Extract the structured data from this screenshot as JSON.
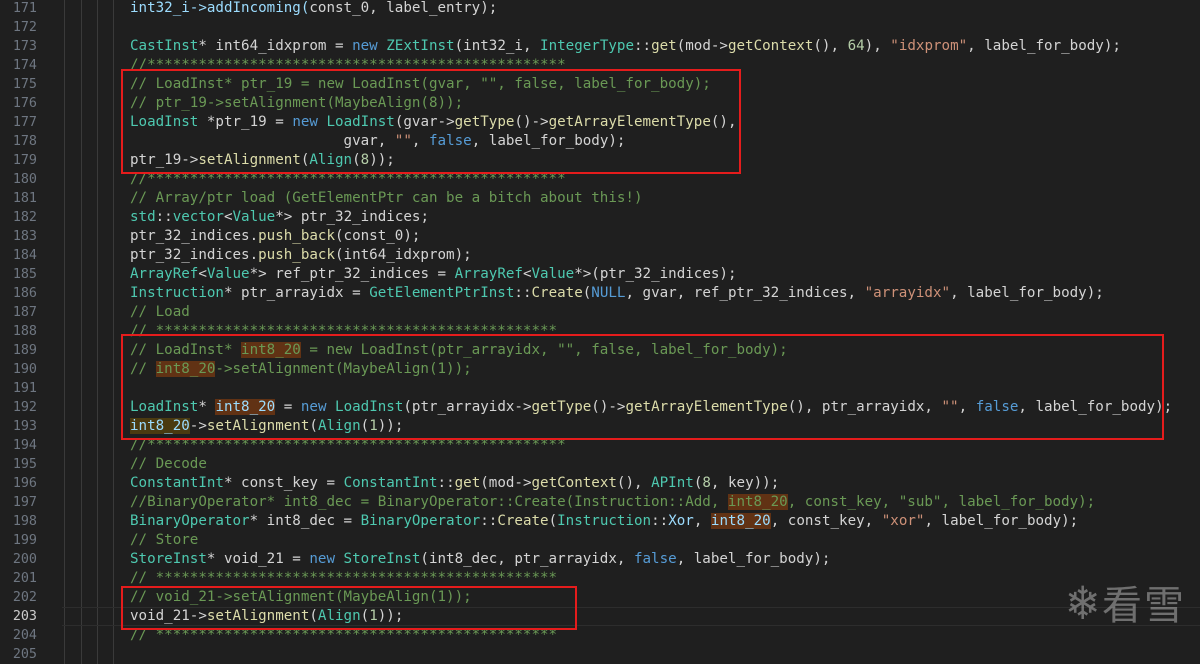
{
  "editor": {
    "current_line": 203,
    "lines": [
      {
        "n": 171,
        "tokens": [
          [
            "int32_i->addIncoming(",
            "var"
          ],
          [
            "const_0, label_entry",
            ""
          ],
          [
            ");",
            ""
          ]
        ]
      },
      {
        "n": 172,
        "tokens": []
      },
      {
        "n": 173,
        "tokens": [
          [
            "CastInst",
            "type"
          ],
          [
            "* int64_idxprom = ",
            ""
          ],
          [
            "new ",
            "kw"
          ],
          [
            "ZExtInst",
            "type"
          ],
          [
            "(int32_i, ",
            ""
          ],
          [
            "IntegerType",
            "type"
          ],
          [
            "::",
            ""
          ],
          [
            "get",
            "fn"
          ],
          [
            "(mod->",
            ""
          ],
          [
            "getContext",
            "fn"
          ],
          [
            "(), ",
            ""
          ],
          [
            "64",
            "num"
          ],
          [
            "), ",
            ""
          ],
          [
            "\"idxprom\"",
            "str"
          ],
          [
            ", label_for_body);",
            ""
          ]
        ]
      },
      {
        "n": 174,
        "tokens": [
          [
            "//*************************************************",
            "cm"
          ]
        ]
      },
      {
        "n": 175,
        "tokens": [
          [
            "// LoadInst* ptr_19 = new LoadInst(gvar, \"\", false, label_for_body);",
            "cm"
          ]
        ]
      },
      {
        "n": 176,
        "tokens": [
          [
            "// ptr_19->setAlignment(MaybeAlign(8));",
            "cm"
          ]
        ]
      },
      {
        "n": 177,
        "tokens": [
          [
            "LoadInst",
            "type"
          ],
          [
            " *ptr_19 = ",
            ""
          ],
          [
            "new ",
            "kw"
          ],
          [
            "LoadInst",
            "type"
          ],
          [
            "(gvar->",
            ""
          ],
          [
            "getType",
            "fn"
          ],
          [
            "()->",
            ""
          ],
          [
            "getArrayElementType",
            "fn"
          ],
          [
            "(),",
            ""
          ]
        ]
      },
      {
        "n": 178,
        "tokens": [
          [
            "                         gvar, ",
            ""
          ],
          [
            "\"\"",
            "str"
          ],
          [
            ", ",
            ""
          ],
          [
            "false",
            "kw"
          ],
          [
            ", label_for_body);",
            ""
          ]
        ]
      },
      {
        "n": 179,
        "tokens": [
          [
            "ptr_19->",
            ""
          ],
          [
            "setAlignment",
            "fn"
          ],
          [
            "(",
            ""
          ],
          [
            "Align",
            "type"
          ],
          [
            "(",
            ""
          ],
          [
            "8",
            "num"
          ],
          [
            "));",
            ""
          ]
        ]
      },
      {
        "n": 180,
        "tokens": [
          [
            "//*************************************************",
            "cm"
          ]
        ]
      },
      {
        "n": 181,
        "tokens": [
          [
            "// Array/ptr load (GetElementPtr can be a bitch about this!)",
            "cm"
          ]
        ]
      },
      {
        "n": 182,
        "tokens": [
          [
            "std",
            "type"
          ],
          [
            "::",
            ""
          ],
          [
            "vector",
            "type"
          ],
          [
            "<",
            ""
          ],
          [
            "Value",
            "type"
          ],
          [
            "*> ptr_32_indices;",
            ""
          ]
        ]
      },
      {
        "n": 183,
        "tokens": [
          [
            "ptr_32_indices.",
            ""
          ],
          [
            "push_back",
            "fn"
          ],
          [
            "(const_0);",
            ""
          ]
        ]
      },
      {
        "n": 184,
        "tokens": [
          [
            "ptr_32_indices.",
            ""
          ],
          [
            "push_back",
            "fn"
          ],
          [
            "(int64_idxprom);",
            ""
          ]
        ]
      },
      {
        "n": 185,
        "tokens": [
          [
            "ArrayRef",
            "type"
          ],
          [
            "<",
            ""
          ],
          [
            "Value",
            "type"
          ],
          [
            "*> ref_ptr_32_indices = ",
            ""
          ],
          [
            "ArrayRef",
            "type"
          ],
          [
            "<",
            ""
          ],
          [
            "Value",
            "type"
          ],
          [
            "*>(ptr_32_indices);",
            ""
          ]
        ]
      },
      {
        "n": 186,
        "tokens": [
          [
            "Instruction",
            "type"
          ],
          [
            "* ptr_arrayidx = ",
            ""
          ],
          [
            "GetElementPtrInst",
            "type"
          ],
          [
            "::",
            ""
          ],
          [
            "Create",
            "fn"
          ],
          [
            "(",
            ""
          ],
          [
            "NULL",
            "kw"
          ],
          [
            ", gvar, ref_ptr_32_indices, ",
            ""
          ],
          [
            "\"arrayidx\"",
            "str"
          ],
          [
            ", label_for_body);",
            ""
          ]
        ]
      },
      {
        "n": 187,
        "tokens": [
          [
            "// Load",
            "cm"
          ]
        ]
      },
      {
        "n": 188,
        "tokens": [
          [
            "// ***********************************************",
            "cm"
          ]
        ]
      },
      {
        "n": 189,
        "tokens": [
          [
            "// LoadInst* ",
            "cm"
          ],
          [
            "int8_20",
            "cmhl"
          ],
          [
            " = new LoadInst(ptr_arrayidx, \"\", false, label_for_body);",
            "cm"
          ]
        ]
      },
      {
        "n": 190,
        "tokens": [
          [
            "// ",
            "cm"
          ],
          [
            "int8_20",
            "cmhl"
          ],
          [
            "->setAlignment(MaybeAlign(1));",
            "cm"
          ]
        ]
      },
      {
        "n": 191,
        "tokens": []
      },
      {
        "n": 192,
        "tokens": [
          [
            "LoadInst",
            "type"
          ],
          [
            "* ",
            ""
          ],
          [
            "int8_20",
            "hl"
          ],
          [
            " = ",
            ""
          ],
          [
            "new ",
            "kw"
          ],
          [
            "LoadInst",
            "type"
          ],
          [
            "(ptr_arrayidx->",
            ""
          ],
          [
            "getType",
            "fn"
          ],
          [
            "()->",
            ""
          ],
          [
            "getArrayElementType",
            "fn"
          ],
          [
            "(), ptr_arrayidx, ",
            ""
          ],
          [
            "\"\"",
            "str"
          ],
          [
            ", ",
            ""
          ],
          [
            "false",
            "kw"
          ],
          [
            ", label_for_body);",
            ""
          ]
        ]
      },
      {
        "n": 193,
        "tokens": [
          [
            "int8_20",
            "hl2"
          ],
          [
            "->",
            ""
          ],
          [
            "setAlignment",
            "fn"
          ],
          [
            "(",
            ""
          ],
          [
            "Align",
            "type"
          ],
          [
            "(",
            ""
          ],
          [
            "1",
            "num"
          ],
          [
            "));",
            ""
          ]
        ]
      },
      {
        "n": 194,
        "tokens": [
          [
            "//*************************************************",
            "cm"
          ]
        ]
      },
      {
        "n": 195,
        "tokens": [
          [
            "// Decode",
            "cm"
          ]
        ]
      },
      {
        "n": 196,
        "tokens": [
          [
            "ConstantInt",
            "type"
          ],
          [
            "* const_key = ",
            ""
          ],
          [
            "ConstantInt",
            "type"
          ],
          [
            "::",
            ""
          ],
          [
            "get",
            "fn"
          ],
          [
            "(mod->",
            ""
          ],
          [
            "getContext",
            "fn"
          ],
          [
            "(), ",
            ""
          ],
          [
            "APInt",
            "type"
          ],
          [
            "(",
            ""
          ],
          [
            "8",
            "num"
          ],
          [
            ", key));",
            ""
          ]
        ]
      },
      {
        "n": 197,
        "tokens": [
          [
            "//BinaryOperator* int8_dec = BinaryOperator::Create(Instruction::Add, ",
            "cm"
          ],
          [
            "int8_20",
            "cmhl"
          ],
          [
            ", const_key, \"sub\", label_for_body);",
            "cm"
          ]
        ]
      },
      {
        "n": 198,
        "tokens": [
          [
            "BinaryOperator",
            "type"
          ],
          [
            "* int8_dec = ",
            ""
          ],
          [
            "BinaryOperator",
            "type"
          ],
          [
            "::",
            ""
          ],
          [
            "Create",
            "fn"
          ],
          [
            "(",
            ""
          ],
          [
            "Instruction",
            "type"
          ],
          [
            "::",
            ""
          ],
          [
            "Xor",
            "var"
          ],
          [
            ", ",
            ""
          ],
          [
            "int8_20",
            "hl"
          ],
          [
            ", const_key, ",
            ""
          ],
          [
            "\"xor\"",
            "str"
          ],
          [
            ", label_for_body);",
            ""
          ]
        ]
      },
      {
        "n": 199,
        "tokens": [
          [
            "// Store",
            "cm"
          ]
        ]
      },
      {
        "n": 200,
        "tokens": [
          [
            "StoreInst",
            "type"
          ],
          [
            "* void_21 = ",
            ""
          ],
          [
            "new ",
            "kw"
          ],
          [
            "StoreInst",
            "type"
          ],
          [
            "(int8_dec, ptr_arrayidx, ",
            ""
          ],
          [
            "false",
            "kw"
          ],
          [
            ", label_for_body);",
            ""
          ]
        ]
      },
      {
        "n": 201,
        "tokens": [
          [
            "// ***********************************************",
            "cm"
          ]
        ]
      },
      {
        "n": 202,
        "tokens": [
          [
            "// void_21->setAlignment(MaybeAlign(1));",
            "cm"
          ]
        ]
      },
      {
        "n": 203,
        "tokens": [
          [
            "void_21->",
            ""
          ],
          [
            "setAlignment",
            "fn"
          ],
          [
            "(",
            ""
          ],
          [
            "Align",
            "type"
          ],
          [
            "(",
            ""
          ],
          [
            "1",
            "num"
          ],
          [
            "));",
            ""
          ]
        ]
      },
      {
        "n": 204,
        "tokens": [
          [
            "// ***********************************************",
            "cm"
          ]
        ]
      },
      {
        "n": 205,
        "tokens": []
      }
    ]
  },
  "watermark": {
    "icon": "snowflake-icon",
    "text": "看雪"
  },
  "colors": {
    "highlight_box": "#e51c1c",
    "background": "#1f1f1f"
  }
}
